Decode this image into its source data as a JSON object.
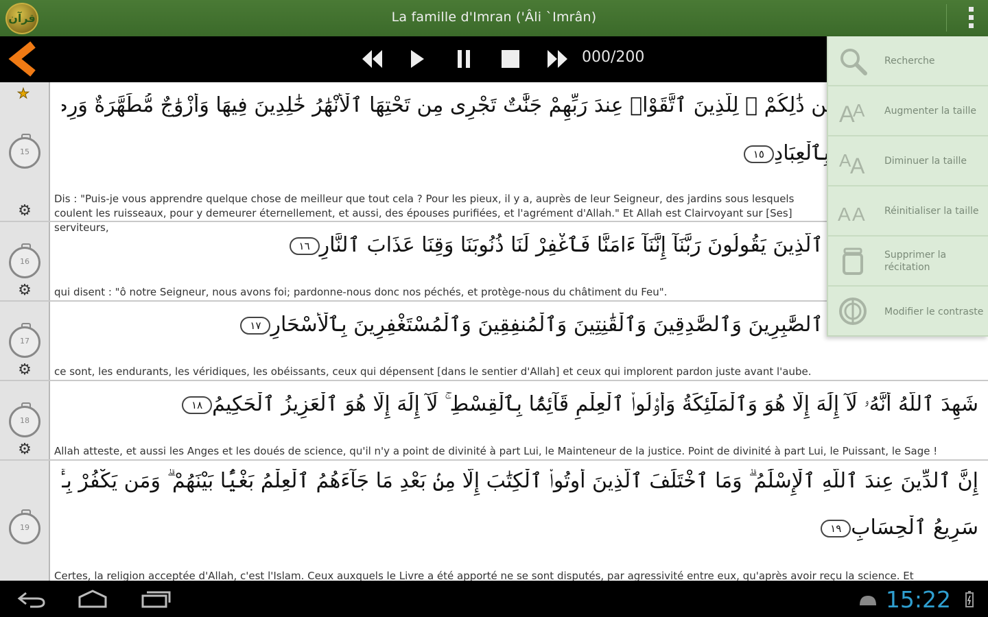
{
  "app": {
    "title": "La famille d'Imran ('Âli `Imrân)",
    "logo_text": "قرآن"
  },
  "player": {
    "counter": "000/200"
  },
  "menu": {
    "items": [
      {
        "label": "Recherche",
        "icon": "search-icon"
      },
      {
        "label": "Augmenter la taille",
        "icon": "text-size-increase-icon"
      },
      {
        "label": "Diminuer la taille",
        "icon": "text-size-decrease-icon"
      },
      {
        "label": "Réinitialiser la taille",
        "icon": "text-size-reset-icon"
      },
      {
        "label": "Supprimer la récitation",
        "icon": "trash-icon"
      },
      {
        "label": "Modifier le contraste",
        "icon": "contrast-icon"
      }
    ]
  },
  "verses": [
    {
      "number": "15",
      "arabic_number": "١٥",
      "arabic": "قُلْ أَؤُنَبِّئُكُم بِخَيْرٍ مِّن ذَٰلِكُمْ ۚ لِلَّذِينَ ٱتَّقَوْا۟ عِندَ رَبِّهِمْ جَنَّٰتٌ تَجْرِى مِن تَحْتِهَا ٱلْأَنْهَٰرُ خَٰلِدِينَ فِيهَا وَأَزْوَٰجٌ مُّطَهَّرَةٌ وَرِضْوَٰنٌ مِّنَ",
      "arabic_line2": "ٱللَّهِ ۗ وَٱللَّهُ بَصِيرٌۢ بِٱلْعِبَادِ",
      "french": "Dis : \"Puis-je vous apprendre quelque chose de meilleur que tout cela ? Pour les pieux, il y a, auprès de leur Seigneur, des jardins sous lesquels coulent les ruisseaux, pour y demeurer éternellement, et aussi, des épouses purifiées, et l'agrément d'Allah.\" Et Allah est Clairvoyant sur [Ses] serviteurs,"
    },
    {
      "number": "16",
      "arabic_number": "١٦",
      "arabic": "ٱلَّذِينَ يَقُولُونَ رَبَّنَآ إِنَّنَآ ءَامَنَّا فَٱغْفِرْ لَنَا ذُنُوبَنَا وَقِنَا عَذَابَ ٱلنَّارِ",
      "french": "qui disent : \"ô notre Seigneur, nous avons foi; pardonne-nous donc nos péchés, et protège-nous du châtiment du Feu\"."
    },
    {
      "number": "17",
      "arabic_number": "١٧",
      "arabic": "ٱلصَّٰبِرِينَ وَٱلصَّٰدِقِينَ وَٱلْقَٰنِتِينَ وَٱلْمُنفِقِينَ وَٱلْمُسْتَغْفِرِينَ بِٱلْأَسْحَارِ",
      "french": "ce sont, les endurants, les véridiques, les obéissants, ceux qui dépensent [dans le sentier d'Allah] et ceux qui implorent pardon juste avant l'aube."
    },
    {
      "number": "18",
      "arabic_number": "١٨",
      "arabic": "شَهِدَ ٱللَّهُ أَنَّهُۥ لَآ إِلَٰهَ إِلَّا هُوَ وَٱلْمَلَٰٓئِكَةُ وَأُو۟لُوا۟ ٱلْعِلْمِ قَآئِمًۢا بِٱلْقِسْطِ ۚ لَآ إِلَٰهَ إِلَّا هُوَ ٱلْعَزِيزُ ٱلْحَكِيمُ",
      "french": "Allah atteste, et aussi les Anges et les doués de science, qu'il n'y a point de divinité à part Lui, le Mainteneur de la justice. Point de divinité à part Lui, le Puissant, le Sage !"
    },
    {
      "number": "19",
      "arabic_number": "١٩",
      "arabic": "إِنَّ ٱلدِّينَ عِندَ ٱللَّهِ ٱلْإِسْلَٰمُ ۗ وَمَا ٱخْتَلَفَ ٱلَّذِينَ أُوتُوا۟ ٱلْكِتَٰبَ إِلَّا مِنۢ بَعْدِ مَا جَآءَهُمُ ٱلْعِلْمُ بَغْيًۢا بَيْنَهُمْ ۗ وَمَن يَكْفُرْ بِـَٔايَٰتِ ٱللَّهِ فَإِنَّ ٱللَّهَ",
      "arabic_line2": "سَرِيعُ ٱلْحِسَابِ",
      "french": "Certes, la religion acceptée d'Allah, c'est l'Islam. Ceux auxquels le Livre a été apporté ne se sont disputés, par agressivité entre eux, qu'après avoir reçu la science. Et"
    }
  ],
  "system": {
    "clock": "15:22"
  },
  "colors": {
    "titlebar": "#3f6e2d",
    "menu_bg": "#dcebd8",
    "clock": "#2f9fd0",
    "back_arrow": "#f07a14"
  }
}
